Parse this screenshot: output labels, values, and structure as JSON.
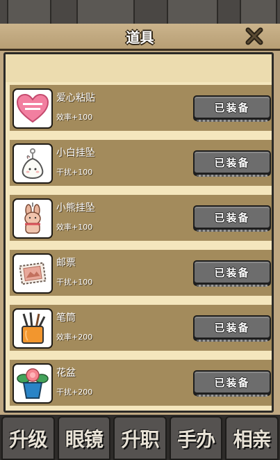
{
  "modal": {
    "title": "道具"
  },
  "items": [
    {
      "name": "爱心粘贴",
      "stat": "效率+100",
      "button": "已装备",
      "icon": "heart-sticker-icon"
    },
    {
      "name": "小白挂坠",
      "stat": "干扰+100",
      "button": "已装备",
      "icon": "white-pendant-icon"
    },
    {
      "name": "小熊挂坠",
      "stat": "效率+100",
      "button": "已装备",
      "icon": "bear-pendant-icon"
    },
    {
      "name": "邮票",
      "stat": "干扰+100",
      "button": "已装备",
      "icon": "stamp-icon"
    },
    {
      "name": "笔筒",
      "stat": "效率+200",
      "button": "已装备",
      "icon": "pen-holder-icon"
    },
    {
      "name": "花盆",
      "stat": "干扰+200",
      "button": "已装备",
      "icon": "flower-pot-icon"
    }
  ],
  "bottom_nav": [
    "升级",
    "眼镜",
    "升职",
    "手办",
    "相亲"
  ],
  "colors": {
    "row_bg": "#a38b5c",
    "panel_bg": "#f4e6bd",
    "header_bg": "#bfa882",
    "button_bg": "#6d6d6d"
  }
}
